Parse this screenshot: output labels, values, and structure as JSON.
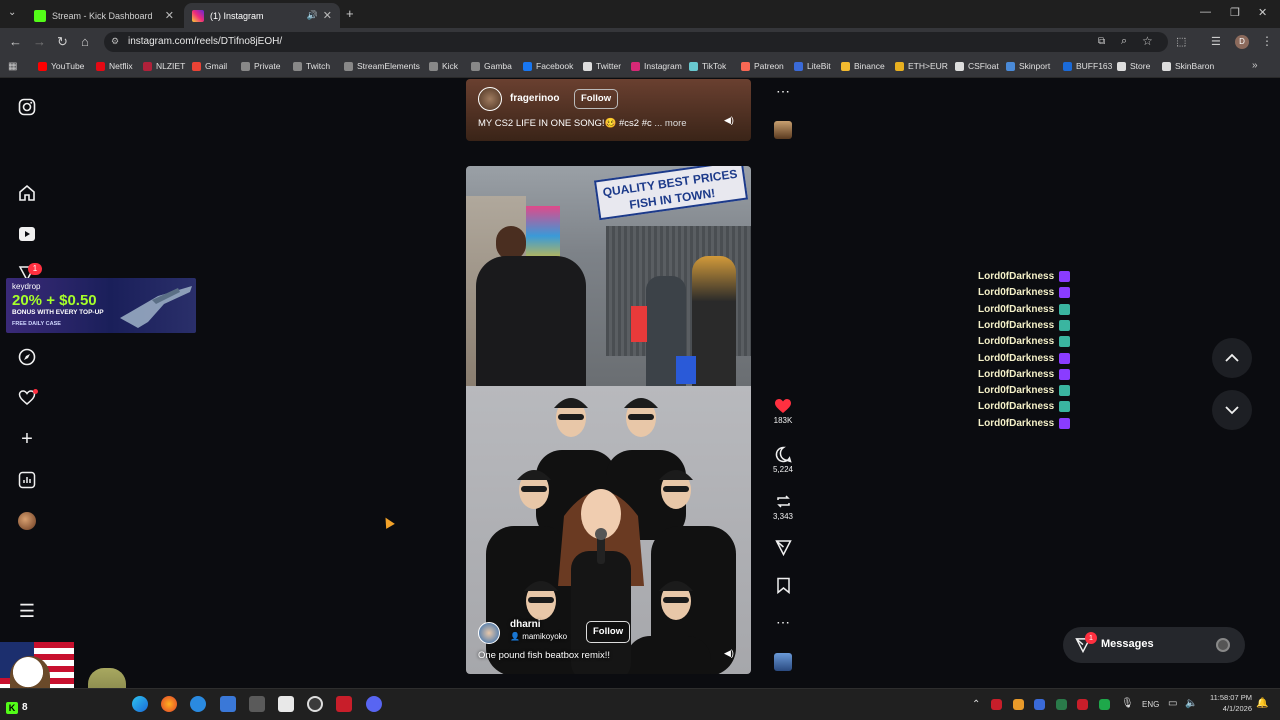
{
  "browser": {
    "tabs": [
      {
        "title": "Stream - Kick Dashboard",
        "active": false
      },
      {
        "title": "(1) Instagram",
        "active": true
      }
    ],
    "url": "instagram.com/reels/DTifno8jEOH/",
    "bookmarks": [
      "YouTube",
      "Netflix",
      "NLZIET",
      "Gmail",
      "Private",
      "Twitch",
      "StreamElements",
      "Kick",
      "Gamba",
      "Facebook",
      "Twitter",
      "Instagram",
      "TikTok",
      "Patreon",
      "LiteBit",
      "Binance",
      "ETH>EUR",
      "CSFloat",
      "Skinport",
      "BUFF163",
      "Store",
      "SkinBaron"
    ],
    "profile_initial": "D"
  },
  "sidebar": {
    "notification_count": "1"
  },
  "ad": {
    "brand": "keydrop",
    "headline": "20% + $0.50",
    "sub": "BONUS WITH EVERY TOP-UP",
    "tag": "FREE DAILY CASE"
  },
  "reel_top": {
    "username": "fragerinoo",
    "follow": "Follow",
    "caption": "MY CS2 LIFE IN ONE SONG!🥴 #cs2 #c",
    "more": "... more"
  },
  "reel_main": {
    "sign_text": "QUALITY BEST PRICES FISH IN TOWN!",
    "username": "dharni",
    "collab": "mamikoyoko",
    "follow": "Follow",
    "caption": "One pound fish beatbox remix!!"
  },
  "actions": {
    "likes": "183K",
    "comments": "5,224",
    "reposts": "3,343"
  },
  "chat": {
    "lines": [
      "Lord0fDarkness",
      "Lord0fDarkness",
      "Lord0fDarkness",
      "Lord0fDarkness",
      "Lord0fDarkness",
      "Lord0fDarkness",
      "Lord0fDarkness",
      "Lord0fDarkness",
      "Lord0fDarkness",
      "Lord0fDarkness"
    ]
  },
  "messages": {
    "label": "Messages",
    "count": "1"
  },
  "taskbar": {
    "lang": "ENG",
    "time": "11:58:07 PM",
    "date": "4/1/2026",
    "stream_count": "8"
  },
  "colors": {
    "like": "#ff3040",
    "chat_name": "#f4f0c8",
    "badge_purple": "#8a3cff",
    "badge_teal": "#3ab5a0"
  }
}
